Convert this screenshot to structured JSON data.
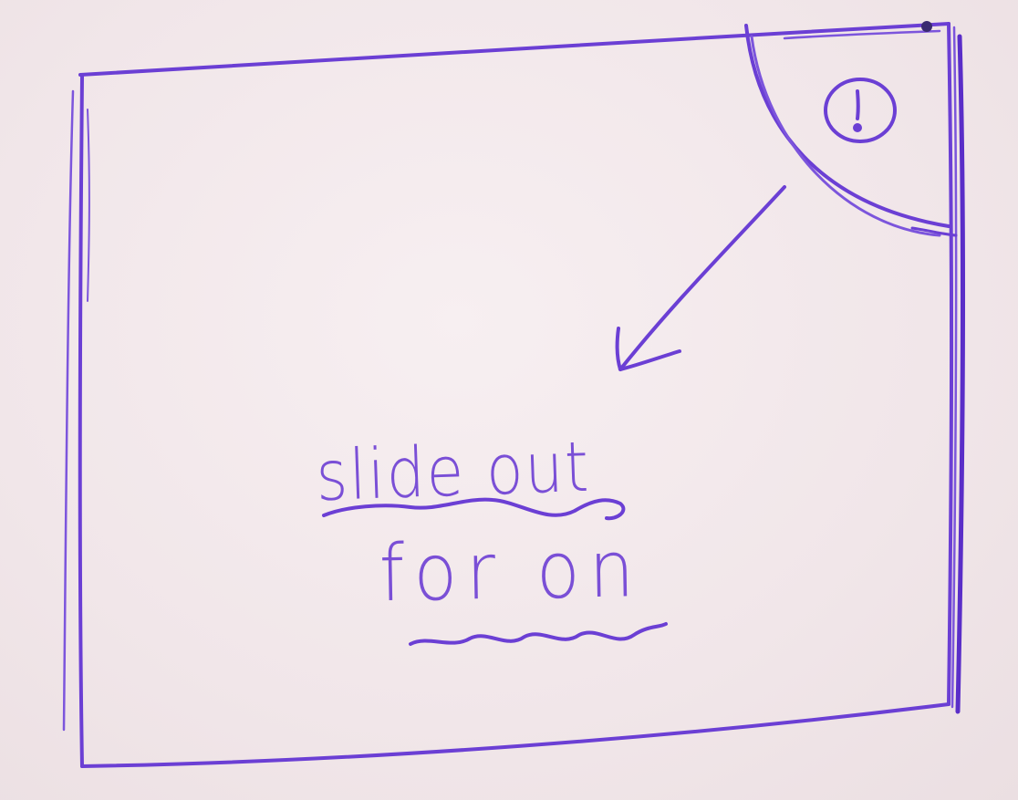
{
  "sketch": {
    "ink_color": "#6a3fd0",
    "paper_color": "#f3eaed",
    "text_lines": [
      "slide out",
      "for on"
    ],
    "corner_icon": "exclamation-circle-icon"
  }
}
